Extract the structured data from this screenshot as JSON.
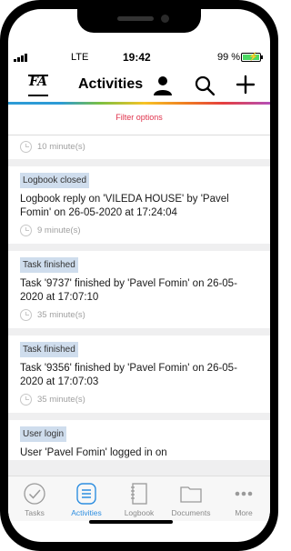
{
  "status": {
    "network": "LTE",
    "time": "19:42",
    "battery": "99 %",
    "battery_level": 0.99,
    "battery_color": "#4cd964"
  },
  "header": {
    "title": "Activities",
    "icons": [
      "fa-logo",
      "person-icon",
      "search-icon",
      "plus-icon"
    ]
  },
  "filter_label": "Filter options",
  "feed": {
    "partial_top_time": "10 minute(s)",
    "items": [
      {
        "tag": "Logbook closed",
        "message": "Logbook reply on 'VILEDA HOUSE' by 'Pavel Fomin' on 26-05-2020 at 17:24:04",
        "time": "9 minute(s)"
      },
      {
        "tag": "Task finished",
        "message": "Task '9737' finished by 'Pavel Fomin' on 26-05-2020 at 17:07:10",
        "time": "35 minute(s)"
      },
      {
        "tag": "Task finished",
        "message": "Task '9356' finished by 'Pavel Fomin' on 26-05-2020 at 17:07:03",
        "time": "35 minute(s)"
      },
      {
        "tag": "User login",
        "message": "User 'Pavel Fomin' logged in on"
      }
    ]
  },
  "tabs": [
    {
      "label": "Tasks",
      "icon": "check-circle-icon"
    },
    {
      "label": "Activities",
      "icon": "list-icon",
      "active": true
    },
    {
      "label": "Logbook",
      "icon": "notebook-icon"
    },
    {
      "label": "Documents",
      "icon": "folder-icon"
    },
    {
      "label": "More",
      "icon": "more-icon"
    }
  ],
  "colors": {
    "accent": "#2d8ee0",
    "filter_text": "#e0334c",
    "tag_bg": "#cfdded"
  }
}
